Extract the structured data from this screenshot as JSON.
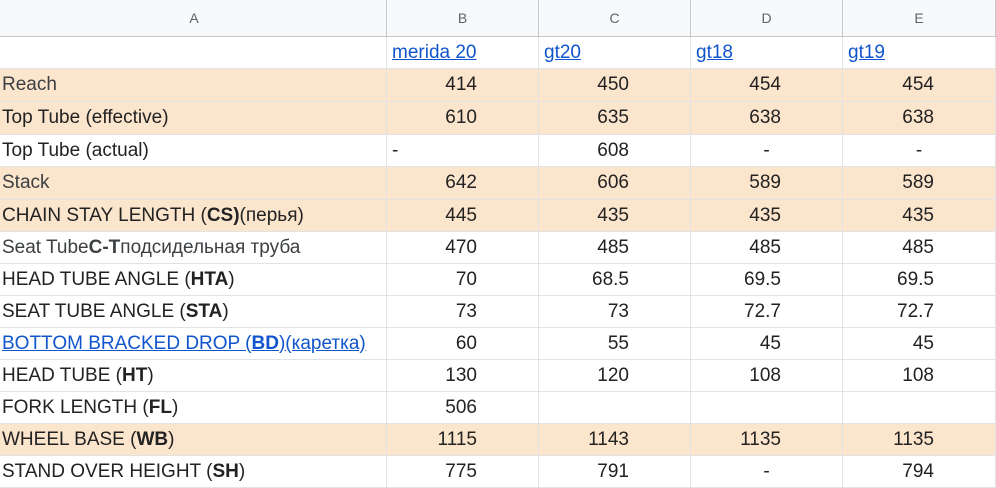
{
  "columns": [
    "A",
    "B",
    "C",
    "D",
    "E"
  ],
  "bikes": [
    "merida 20",
    "gt20",
    "gt18",
    "gt19"
  ],
  "rows": [
    {
      "label": "Reach",
      "values": [
        "414",
        "450",
        "454",
        "454"
      ]
    },
    {
      "label": "Top Tube (effective)",
      "values": [
        "610",
        "635",
        "638",
        "638"
      ]
    },
    {
      "label": "Top Tube (actual)",
      "values": [
        "-",
        "608",
        "-",
        "-"
      ]
    },
    {
      "label": "Stack",
      "values": [
        "642",
        "606",
        "589",
        "589"
      ]
    },
    {
      "label_pre": "CHAIN STAY LENGTH (",
      "label_bold": "CS)",
      "label_post": " (перья)",
      "values": [
        "445",
        "435",
        "435",
        "435"
      ]
    },
    {
      "label_pre": "Seat Tube ",
      "label_bold": "C-T",
      "label_post": " подсидельная труба",
      "values": [
        "470",
        "485",
        "485",
        "485"
      ]
    },
    {
      "label_pre": "HEAD TUBE ANGLE (",
      "label_bold": "HTA",
      "label_post": ")",
      "values": [
        "70",
        "68.5",
        "69.5",
        "69.5"
      ]
    },
    {
      "label_pre": "SEAT TUBE ANGLE (",
      "label_bold": "STA",
      "label_post": ")",
      "values": [
        "73",
        "73",
        "72.7",
        "72.7"
      ]
    },
    {
      "label_pre": "BOTTOM BRACKED DROP (",
      "label_bold": "BD",
      "label_post": ")(каретка)",
      "values": [
        "60",
        "55",
        "45",
        "45"
      ]
    },
    {
      "label_pre": "HEAD TUBE (",
      "label_bold": "HT",
      "label_post": ")",
      "values": [
        "130",
        "120",
        "108",
        "108"
      ]
    },
    {
      "label_pre": "FORK LENGTH (",
      "label_bold": "FL",
      "label_post": ")",
      "values": [
        "506",
        "",
        "",
        ""
      ]
    },
    {
      "label_pre": "WHEEL BASE (",
      "label_bold": "WB",
      "label_post": ")",
      "values": [
        "1115",
        "1143",
        "1135",
        "1135"
      ]
    },
    {
      "label_pre": "STAND OVER HEIGHT (",
      "label_bold": "SH",
      "label_post": ")",
      "values": [
        "775",
        "791",
        "-",
        "794"
      ]
    }
  ],
  "colors": {
    "highlight": "#fce5cd",
    "link": "#1155cc",
    "header_bg": "#f8f9fa"
  }
}
